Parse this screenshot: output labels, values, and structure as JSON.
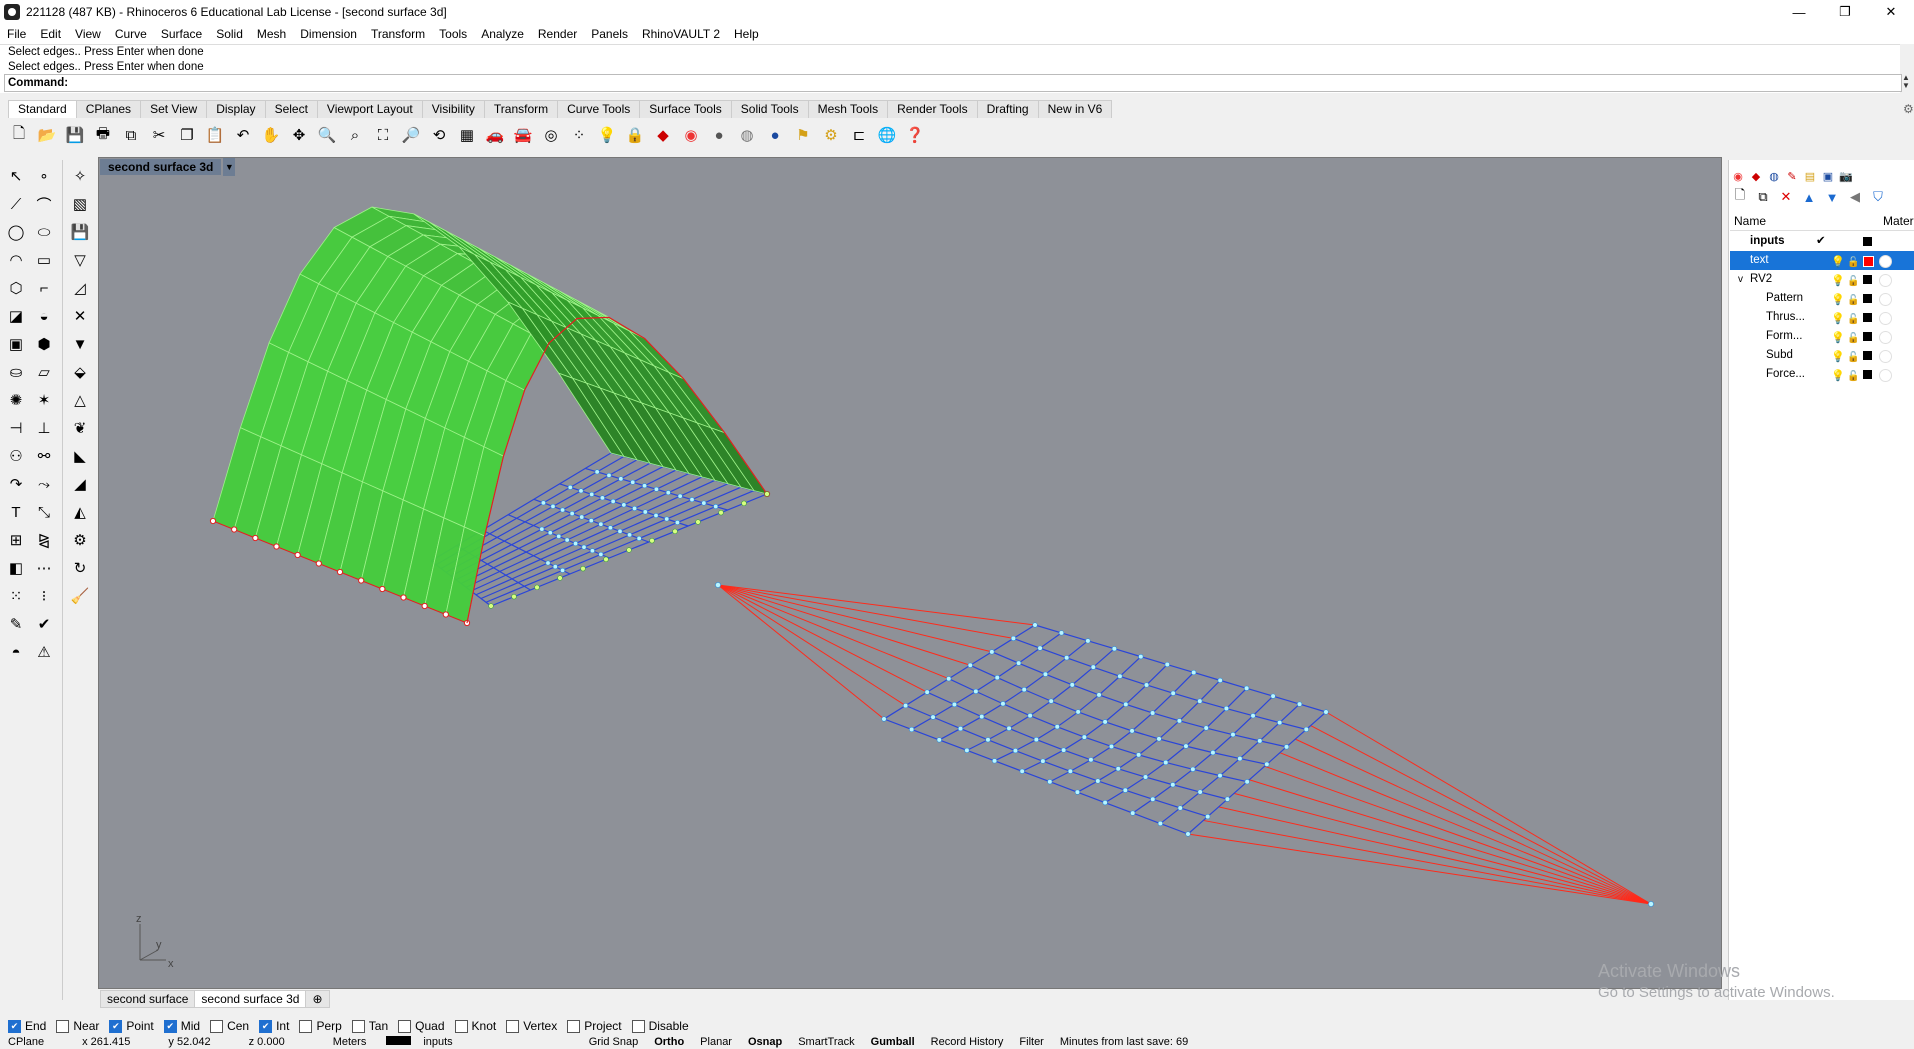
{
  "window": {
    "title": "221128 (487 KB) - Rhinoceros 6 Educational Lab License - [second surface 3d]",
    "controls": [
      "—",
      "❐",
      "✕"
    ]
  },
  "menu": [
    "File",
    "Edit",
    "View",
    "Curve",
    "Surface",
    "Solid",
    "Mesh",
    "Dimension",
    "Transform",
    "Tools",
    "Analyze",
    "Render",
    "Panels",
    "RhinoVAULT 2",
    "Help"
  ],
  "command": {
    "history": [
      "Select edges.. Press Enter when done",
      "Select edges.. Press Enter when done"
    ],
    "prompt": "Command:",
    "value": ""
  },
  "toolbar_tabs": [
    "Standard",
    "CPlanes",
    "Set View",
    "Display",
    "Select",
    "Viewport Layout",
    "Visibility",
    "Transform",
    "Curve Tools",
    "Surface Tools",
    "Solid Tools",
    "Mesh Tools",
    "Render Tools",
    "Drafting",
    "New in V6"
  ],
  "active_tab": "Standard",
  "viewport": {
    "title": "second surface 3d",
    "axes": {
      "z": "z",
      "y": "y",
      "x": "x"
    }
  },
  "view_tabs": [
    "second surface",
    "second surface 3d"
  ],
  "active_view": "second surface 3d",
  "layers": {
    "header_name": "Name",
    "header_material": "Mater",
    "rows": [
      {
        "name": "inputs",
        "bold": true,
        "check": "✔",
        "swatch": "#000000"
      },
      {
        "name": "text",
        "selected": true,
        "swatch": "#ff0000"
      },
      {
        "name": "RV2",
        "expand": "v",
        "swatch": "#000000"
      },
      {
        "name": "Pattern",
        "swatch": "#000000"
      },
      {
        "name": "Thrus...",
        "swatch": "#000000"
      },
      {
        "name": "Form...",
        "swatch": "#000000"
      },
      {
        "name": "Subd",
        "swatch": "#000000"
      },
      {
        "name": "Force...",
        "swatch": "#000000"
      }
    ]
  },
  "watermark": {
    "line1": "Activate Windows",
    "line2": "Go to Settings to activate Windows."
  },
  "osnap": [
    {
      "label": "End",
      "checked": true
    },
    {
      "label": "Near",
      "checked": false
    },
    {
      "label": "Point",
      "checked": true
    },
    {
      "label": "Mid",
      "checked": true
    },
    {
      "label": "Cen",
      "checked": false
    },
    {
      "label": "Int",
      "checked": true
    },
    {
      "label": "Perp",
      "checked": false
    },
    {
      "label": "Tan",
      "checked": false
    },
    {
      "label": "Quad",
      "checked": false
    },
    {
      "label": "Knot",
      "checked": false
    },
    {
      "label": "Vertex",
      "checked": false
    },
    {
      "label": "Project",
      "checked": false
    },
    {
      "label": "Disable",
      "checked": false
    }
  ],
  "status": {
    "cplane": "CPlane",
    "x": "x 261.415",
    "y": "y 52.042",
    "z": "z 0.000",
    "units": "Meters",
    "layer": "inputs",
    "toggles": [
      "Grid Snap",
      "Ortho",
      "Planar",
      "Osnap",
      "SmartTrack",
      "Gumball",
      "Record History",
      "Filter"
    ],
    "save": "Minutes from last save: 69"
  }
}
